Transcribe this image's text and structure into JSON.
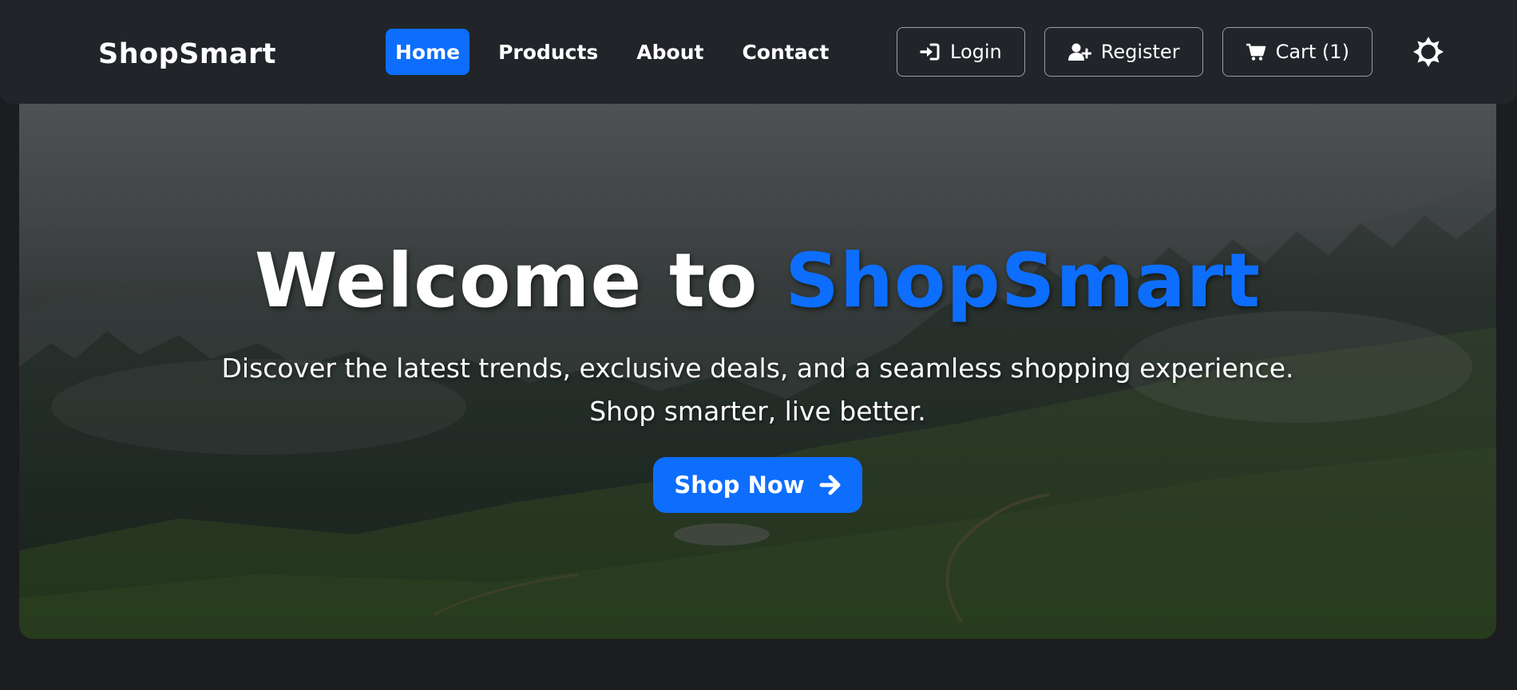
{
  "brand": {
    "name": "ShopSmart"
  },
  "nav": {
    "items": [
      {
        "label": "Home",
        "active": true
      },
      {
        "label": "Products",
        "active": false
      },
      {
        "label": "About",
        "active": false
      },
      {
        "label": "Contact",
        "active": false
      }
    ]
  },
  "actions": {
    "login": {
      "label": "Login",
      "icon": "sign-in-icon"
    },
    "register": {
      "label": "Register",
      "icon": "user-plus-icon"
    },
    "cart": {
      "label": "Cart (1)",
      "icon": "cart-icon"
    },
    "theme_toggle": {
      "icon": "sun-icon"
    }
  },
  "hero": {
    "title_prefix": "Welcome to ",
    "title_accent": "ShopSmart",
    "subtitle_line1": "Discover the latest trends, exclusive deals, and a seamless shopping experience.",
    "subtitle_line2": "Shop smarter, live better.",
    "cta_label": "Shop Now",
    "cta_icon": "arrow-right-icon",
    "background": "misty-forest-hillside"
  },
  "colors": {
    "accent": "#0d6efd",
    "navbar": "#212429",
    "page_background": "#1b1d21",
    "text": "#ffffff"
  }
}
